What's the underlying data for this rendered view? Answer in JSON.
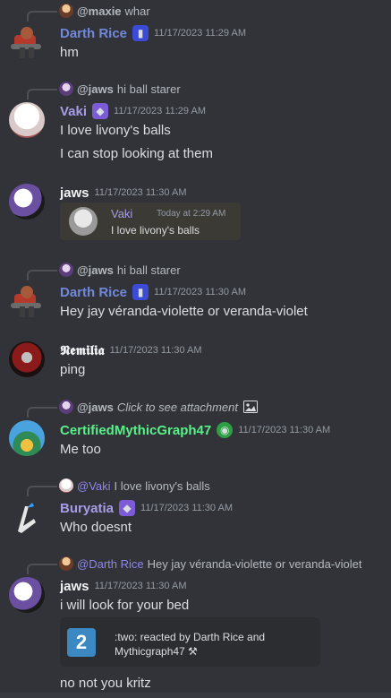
{
  "messages": {
    "m1": {
      "reply": {
        "user": "@maxie",
        "text": "whar"
      },
      "author": "Darth Rice",
      "timestamp": "11/17/2023 11:29 AM",
      "lines": [
        "hm"
      ]
    },
    "m2": {
      "reply": {
        "user": "@jaws",
        "text": "hi ball starer"
      },
      "author": "Vaki",
      "timestamp": "11/17/2023 11:29 AM",
      "lines": [
        "I love livony's balls",
        "I can stop looking at them"
      ]
    },
    "m3": {
      "author": "jaws",
      "timestamp": "11/17/2023 11:30 AM",
      "quote": {
        "author": "Vaki",
        "timestamp": "Today at 2:29 AM",
        "text": "I love livony's balls"
      }
    },
    "m4": {
      "reply": {
        "user": "@jaws",
        "text": "hi ball starer"
      },
      "author": "Darth Rice",
      "timestamp": "11/17/2023 11:30 AM",
      "lines": [
        "Hey jay véranda-violette or veranda-violet"
      ]
    },
    "m5": {
      "author": "𝕹𝖊𝖒𝖎𝖑𝖎𝖆",
      "timestamp": "11/17/2023 11:30 AM",
      "lines": [
        "ping"
      ]
    },
    "m6": {
      "reply": {
        "user": "@jaws",
        "text": "Click to see attachment"
      },
      "author": "CertifiedMythicGraph47",
      "timestamp": "11/17/2023 11:30 AM",
      "lines": [
        "Me too"
      ]
    },
    "m7": {
      "reply": {
        "user": "@Vaki",
        "text": "I love livony's balls"
      },
      "author": "Buryatia",
      "timestamp": "11/17/2023 11:30 AM",
      "lines": [
        "Who doesnt"
      ]
    },
    "m8": {
      "reply": {
        "user": "@Darth Rice",
        "text": "Hey jay véranda-violette or veranda-violet"
      },
      "author": "jaws",
      "timestamp": "11/17/2023 11:30 AM",
      "lines": [
        "i will look for your bed",
        "no not you kritz"
      ],
      "embed": {
        "number": "2",
        "line1": ":two: reacted by Darth Rice and",
        "line2": "Mythicgraph47 ⚒"
      }
    }
  },
  "colors": {
    "background": "#313338",
    "darth_rice": "#7289da",
    "vaki": "#a69de8",
    "certified": "#57f287",
    "buryatia": "#a69de8",
    "default_name": "#f2f3f5",
    "timestamp": "#949ba4"
  }
}
